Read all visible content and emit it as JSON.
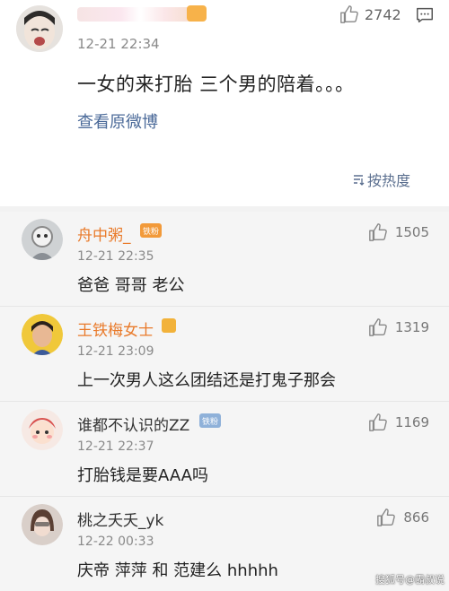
{
  "main_post": {
    "time": "12-21 22:34",
    "text": "一女的来打胎 三个男的陪着。。。",
    "view_original": "查看原微博",
    "likes": "2742",
    "sort_label": "按热度"
  },
  "comments": [
    {
      "name": "舟中粥_",
      "badge": "铁粉",
      "time": "12-21 22:35",
      "text": "爸爸 哥哥 老公",
      "likes": "1505"
    },
    {
      "name": "王铁梅女士",
      "badge": "",
      "time": "12-21 23:09",
      "text": "上一次男人这么团结还是打鬼子那会",
      "likes": "1319"
    },
    {
      "name": "谁都不认识的ZZ",
      "badge": "铁粉",
      "time": "12-21 22:37",
      "text": "打胎钱是要AAA吗",
      "likes": "1169"
    },
    {
      "name": "桃之夭夭_yk",
      "badge": "",
      "time": "12-22 00:33",
      "text": "庆帝 萍萍 和 范建么 hhhhh",
      "likes": "866"
    }
  ],
  "watermark": "搜狐号@霸叔说",
  "colors": {
    "link": "#4b6a99",
    "orange_name": "#e97a2a",
    "badge_orange": "#f7b24a"
  }
}
